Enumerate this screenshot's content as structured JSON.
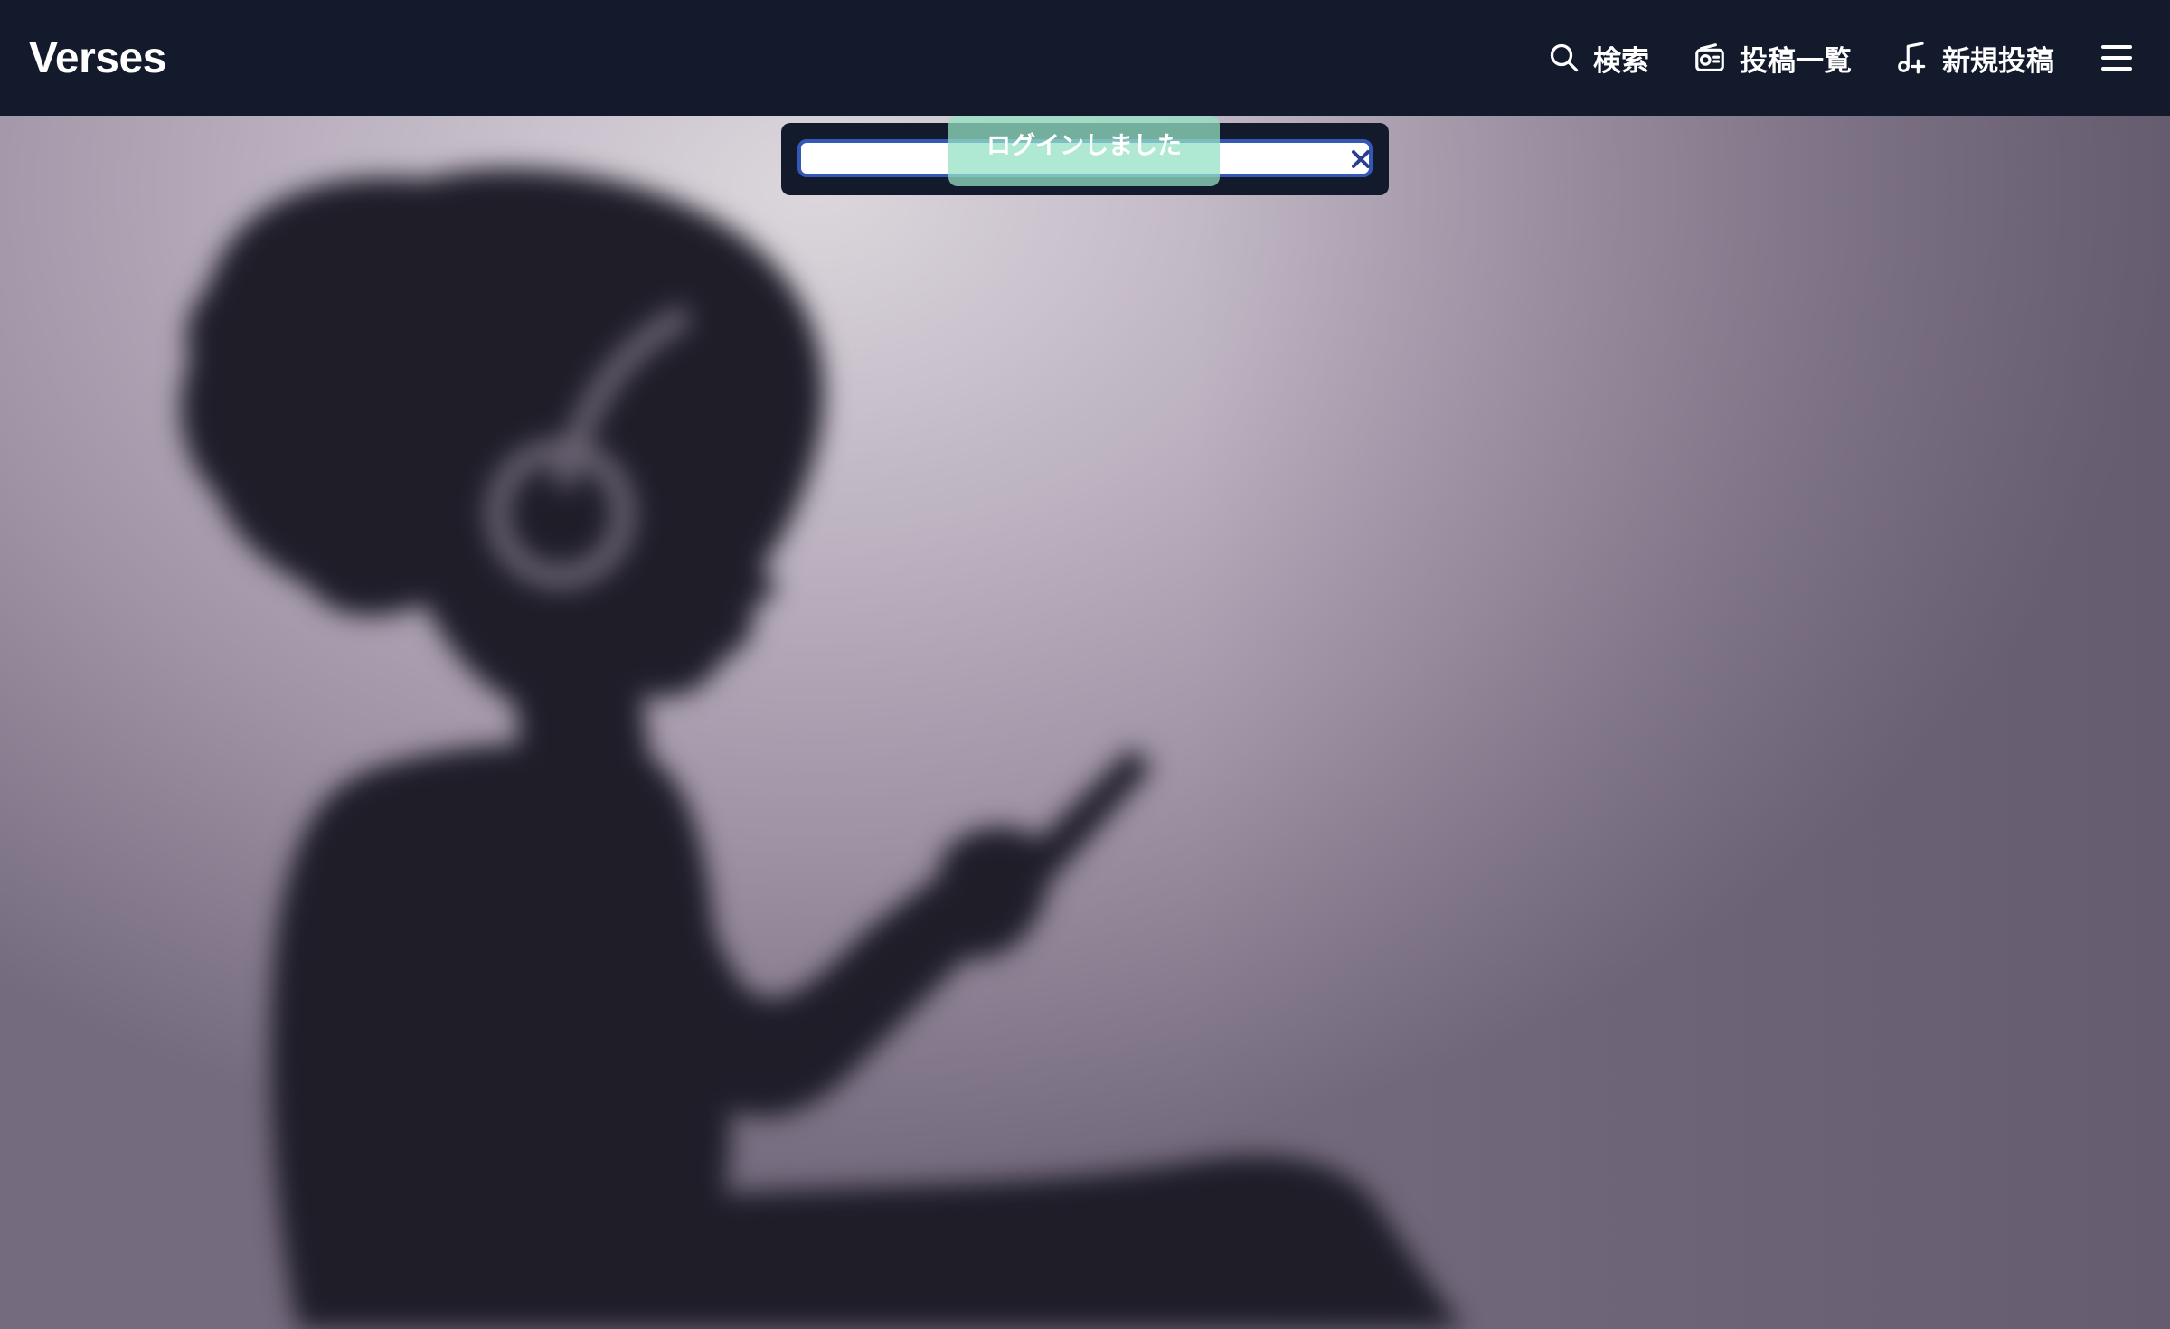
{
  "app": {
    "title": "Verses"
  },
  "header": {
    "nav": {
      "search_label": "検索",
      "posts_list_label": "投稿一覧",
      "new_post_label": "新規投稿"
    },
    "icons": {
      "search": "search-icon",
      "posts_list": "radio-icon",
      "new_post": "music-note-plus-icon",
      "menu": "hamburger-menu-icon"
    }
  },
  "flash": {
    "message": "ログインしました",
    "close_icon": "close-icon"
  },
  "colors": {
    "header_bg": "#121a2c",
    "flash_success": "#96e2c4",
    "input_border": "#3558b8"
  }
}
